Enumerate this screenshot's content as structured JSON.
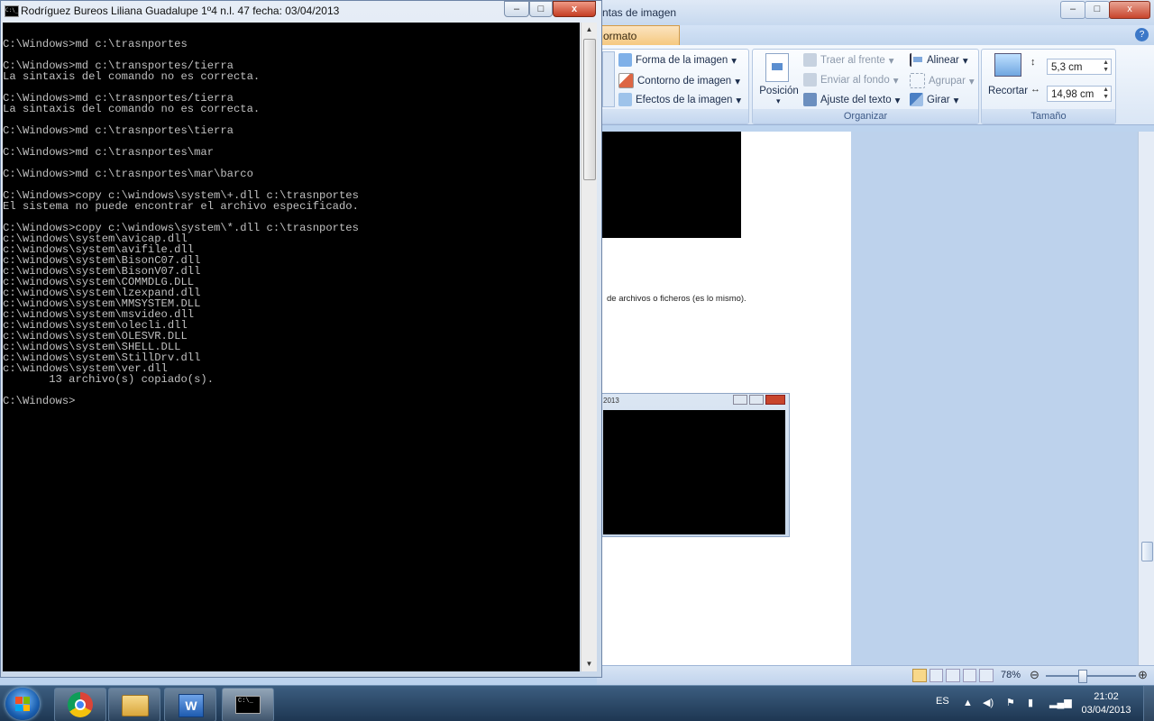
{
  "console": {
    "title": "Rodríguez Bureos Liliana Guadalupe 1º4 n.l. 47 fecha: 03/04/2013",
    "minimize": "–",
    "maximize": "□",
    "close": "x",
    "icon_text": "C:\\_",
    "output": "\nC:\\Windows>md c:\\trasnportes\n\nC:\\Windows>md c:\\transportes/tierra\nLa sintaxis del comando no es correcta.\n\nC:\\Windows>md c:\\trasnportes/tierra\nLa sintaxis del comando no es correcta.\n\nC:\\Windows>md c:\\trasnportes\\tierra\n\nC:\\Windows>md c:\\trasnportes\\mar\n\nC:\\Windows>md c:\\trasnportes\\mar\\barco\n\nC:\\Windows>copy c:\\windows\\system\\+.dll c:\\trasnportes\nEl sistema no puede encontrar el archivo especificado.\n\nC:\\Windows>copy c:\\windows\\system\\*.dll c:\\trasnportes\nc:\\windows\\system\\avicap.dll\nc:\\windows\\system\\avifile.dll\nc:\\windows\\system\\BisonC07.dll\nc:\\windows\\system\\BisonV07.dll\nc:\\windows\\system\\COMMDLG.DLL\nc:\\windows\\system\\lzexpand.dll\nc:\\windows\\system\\MMSYSTEM.DLL\nc:\\windows\\system\\msvideo.dll\nc:\\windows\\system\\olecli.dll\nc:\\windows\\system\\OLESVR.DLL\nc:\\windows\\system\\SHELL.DLL\nc:\\windows\\system\\StillDrv.dll\nc:\\windows\\system\\ver.dll\n       13 archivo(s) copiado(s).\n\nC:\\Windows>"
  },
  "word": {
    "title_fragment": "ntas de imagen",
    "tab_formato": "ormato",
    "help": "?",
    "groups": {
      "estilos": {
        "forma": "Forma de la imagen",
        "contorno": "Contorno de imagen",
        "efectos": "Efectos de la imagen"
      },
      "organizar": {
        "label": "Organizar",
        "posicion": "Posición",
        "traer": "Traer al frente",
        "enviar": "Enviar al fondo",
        "ajuste": "Ajuste del texto",
        "alinear": "Alinear",
        "agrupar": "Agrupar",
        "girar": "Girar"
      },
      "tamano": {
        "label": "Tamaño",
        "recortar": "Recortar",
        "height": "5,3 cm",
        "width": "14,98 cm"
      }
    },
    "doc_text": "de archivos o ficheros (es lo mismo).",
    "mini_window_title": "2013",
    "zoom": "78%"
  },
  "taskbar": {
    "lang": "ES",
    "time": "21:02",
    "date": "03/04/2013",
    "cmd_icon_text": "C:\\_"
  },
  "colors": {
    "console_bg": "#000000",
    "console_fg": "#c0c0c0",
    "taskbar": "#1d3651",
    "word_tab_formato": "#f5c77c"
  }
}
